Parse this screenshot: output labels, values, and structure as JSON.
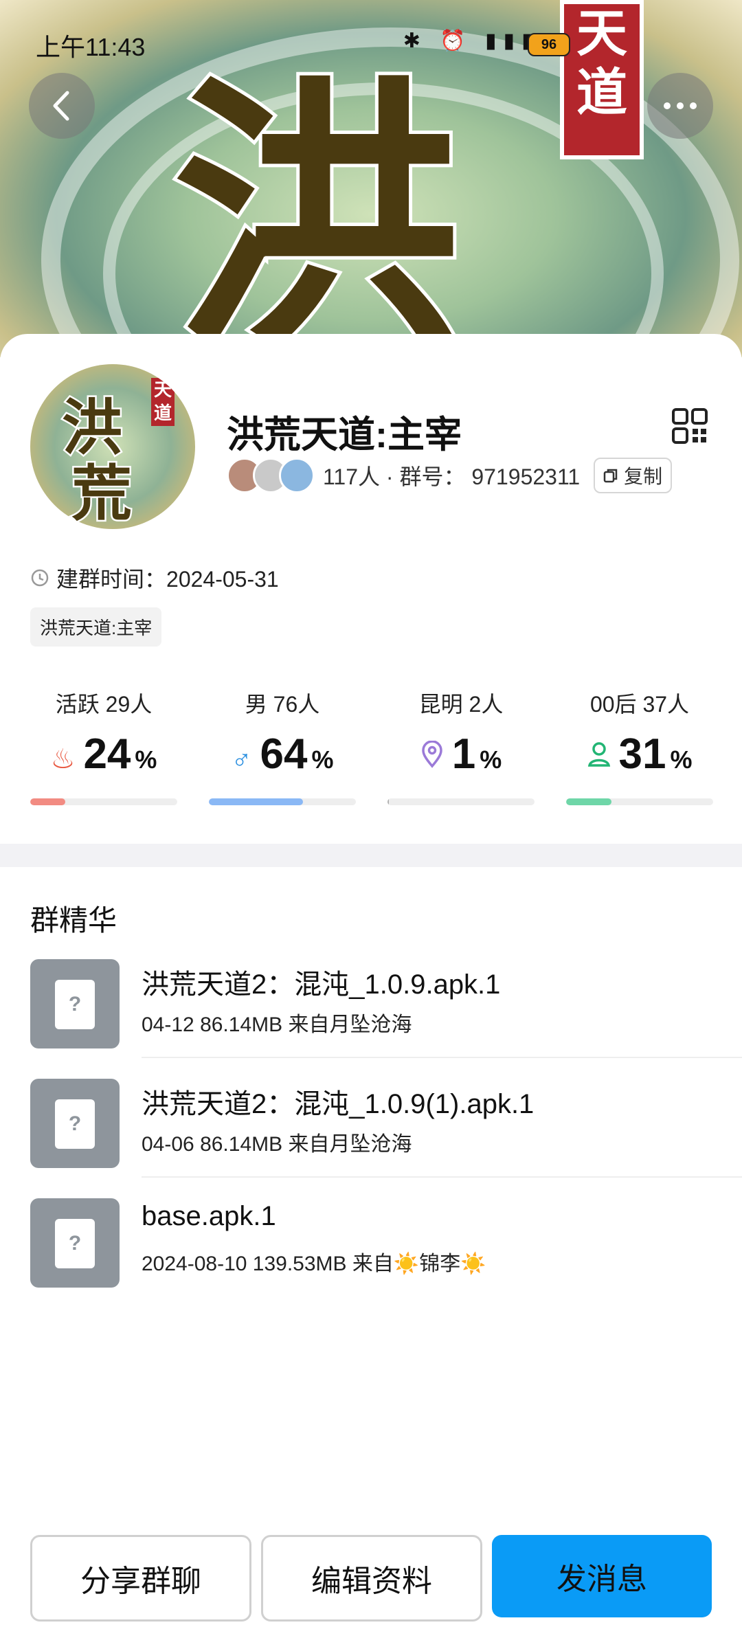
{
  "status_bar": {
    "time": "上午11:43",
    "battery": "96",
    "icons": [
      "bluetooth-icon",
      "alarm-icon",
      "hd-signal-icon",
      "wifi-icon"
    ]
  },
  "header": {
    "back_icon": "chevron-left-icon",
    "more_icon": "more-dots-icon",
    "hero_chars": [
      "洪",
      "天",
      "道"
    ]
  },
  "group": {
    "avatar_chars": [
      "洪",
      "荒",
      "天道"
    ],
    "name": "洪荒天道:主宰",
    "member_count": "117人",
    "group_id_label": "· 群号：",
    "group_id": "971952311",
    "copy_label": "复制",
    "created_label": "建群时间：",
    "created_date": "2024-05-31",
    "tag": "洪荒天道:主宰"
  },
  "stats": [
    {
      "label": "活跃 29人",
      "value": "24",
      "unit": "%",
      "icon": "flame-icon",
      "percent": 24,
      "color": "#f28b82"
    },
    {
      "label": "男 76人",
      "value": "64",
      "unit": "%",
      "icon": "male-icon",
      "percent": 64,
      "color": "#8ab8f5"
    },
    {
      "label": "昆明 2人",
      "value": "1",
      "unit": "%",
      "icon": "location-icon",
      "percent": 1,
      "color": "#b0b0b0"
    },
    {
      "label": "00后 37人",
      "value": "31",
      "unit": "%",
      "icon": "person-icon",
      "percent": 31,
      "color": "#6fd6a8"
    }
  ],
  "essence": {
    "title": "群精华",
    "files": [
      {
        "name": "洪荒天道2：混沌_1.0.9.apk.1",
        "meta": "04-12  86.14MB  来自月坠沧海"
      },
      {
        "name": "洪荒天道2：混沌_1.0.9(1).apk.1",
        "meta": "04-06  86.14MB  来自月坠沧海"
      },
      {
        "name": "base.apk.1",
        "meta": "2024-08-10  139.53MB  来自☀️锦李☀️"
      }
    ]
  },
  "actions": {
    "share": "分享群聊",
    "edit": "编辑资料",
    "send": "发消息"
  },
  "colors": {
    "accent": "#0a9bf6",
    "flame": "#e8573f",
    "male": "#2a8fe0",
    "location": "#9b7ad8",
    "person": "#22b574"
  }
}
